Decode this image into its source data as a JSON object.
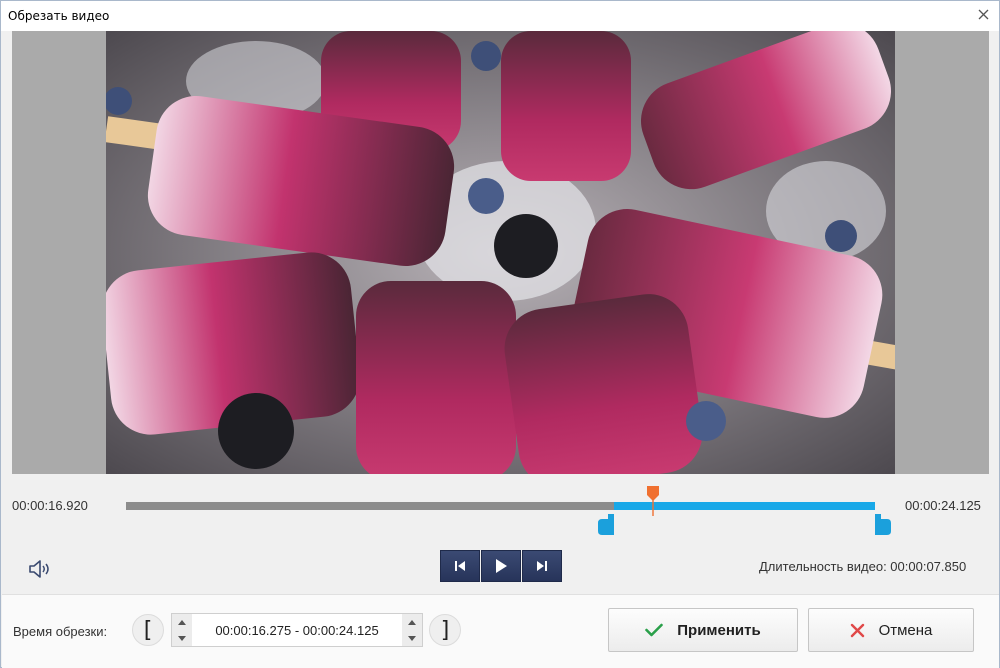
{
  "window": {
    "title": "Обрезать видео"
  },
  "player": {
    "start_time": "00:00:16.920",
    "end_time": "00:00:24.125",
    "selection_start_fraction": 0.652,
    "selection_end_fraction": 1.0,
    "playhead_fraction": 0.703,
    "duration_label": "Длительность видео: 00:00:07.850"
  },
  "cut": {
    "label": "Время обрезки:",
    "range_value": "00:00:16.275 - 00:00:24.125",
    "open_bracket": "[",
    "close_bracket": "]"
  },
  "actions": {
    "apply_label": "Применить",
    "cancel_label": "Отмена"
  },
  "colors": {
    "selection": "#18a8e8",
    "playhead": "#f07030",
    "apply_check": "#2aa04a",
    "cancel_x": "#e04848"
  },
  "icons": {
    "speaker": "speaker-icon",
    "prev": "skip-previous-icon",
    "play": "play-icon",
    "next": "skip-next-icon",
    "check": "check-icon",
    "cross": "close-icon"
  }
}
